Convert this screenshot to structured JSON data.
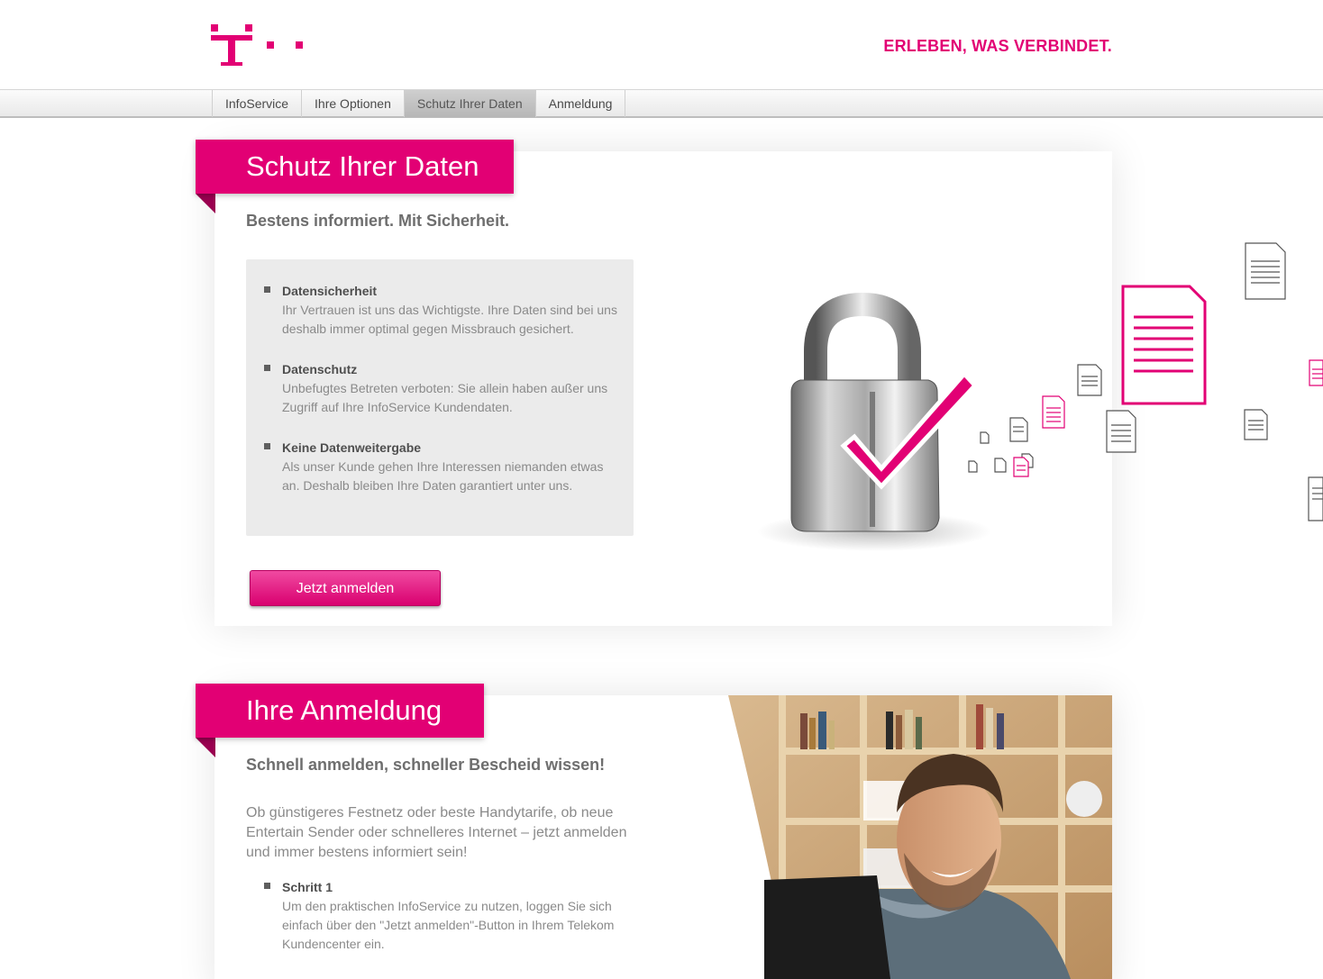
{
  "header": {
    "tagline": "ERLEBEN, WAS VERBINDET."
  },
  "brand_color": "#e20074",
  "nav": {
    "tabs": [
      {
        "label": "InfoService",
        "active": false
      },
      {
        "label": "Ihre Optionen",
        "active": false
      },
      {
        "label": "Schutz Ihrer Daten",
        "active": true
      },
      {
        "label": "Anmeldung",
        "active": false
      }
    ]
  },
  "section_privacy": {
    "title": "Schutz Ihrer Daten",
    "subtitle": "Bestens informiert. Mit Sicherheit.",
    "items": [
      {
        "title": "Datensicherheit",
        "text": "Ihr Vertrauen ist uns das Wichtigste. Ihre Daten sind bei uns deshalb immer optimal gegen Missbrauch gesichert."
      },
      {
        "title": "Datenschutz",
        "text": "Unbefugtes Betreten verboten: Sie allein haben außer uns Zugriff auf Ihre InfoService Kundendaten."
      },
      {
        "title": "Keine Datenweitergabe",
        "text": "Als unser Kunde gehen Ihre Interessen niemanden etwas an. Deshalb bleiben Ihre Daten garantiert unter uns."
      }
    ],
    "cta_label": "Jetzt anmelden",
    "illustration_icon": "padlock-checkmark-icon"
  },
  "section_signup": {
    "title": "Ihre Anmeldung",
    "subtitle": "Schnell anmelden, schneller Bescheid wissen!",
    "intro": "Ob günstigeres Festnetz oder beste Handytarife, ob neue Entertain Sender oder schnelleres Internet – jetzt anmelden und immer bestens informiert sein!",
    "steps": [
      {
        "title": "Schritt 1",
        "text": "Um den praktischen InfoService zu nutzen, loggen Sie sich einfach über den \"Jetzt anmelden\"-Button in Ihrem Telekom Kundencenter ein."
      }
    ]
  }
}
